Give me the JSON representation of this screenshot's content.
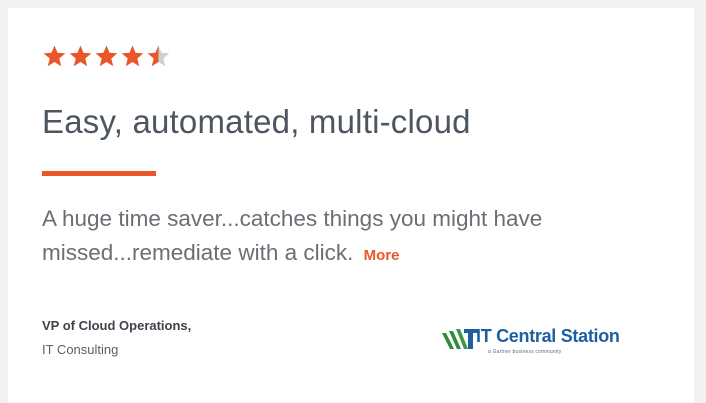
{
  "review": {
    "rating": 4.5,
    "rating_max": 5,
    "title": "Easy, automated, multi-cloud",
    "quote": "A huge time saver...catches things you might have missed...remediate with a click.",
    "more_label": "More"
  },
  "reviewer": {
    "role": "VP of Cloud Operations,",
    "company": "IT Consulting"
  },
  "source_logo": {
    "name": "IT Central Station",
    "tagline": "a Gartner business community"
  },
  "colors": {
    "star": "#e8562a",
    "star_empty": "#cfcfcf",
    "accent": "#e8562a",
    "title": "#4c5560",
    "logo_blue": "#1f5fa0",
    "logo_green": "#2f8a3c"
  },
  "icons": {
    "star": "star-icon",
    "logo_mark": "it-central-station-logo-icon"
  }
}
